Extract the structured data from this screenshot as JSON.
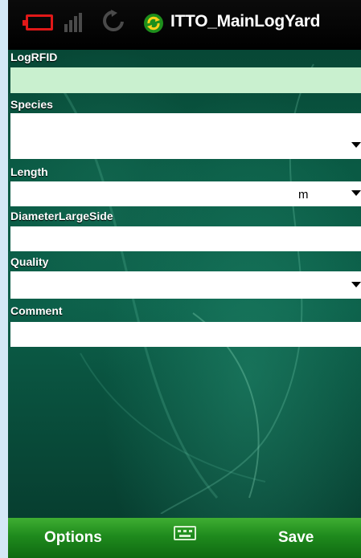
{
  "status_bar": {
    "app_title": "ITTO_MainLogYard",
    "icons": [
      "battery-icon",
      "signal-icon",
      "sync-gray-icon",
      "sync-green-icon"
    ]
  },
  "form": {
    "logrfid": {
      "label": "LogRFID",
      "value": ""
    },
    "species": {
      "label": "Species",
      "value": ""
    },
    "length": {
      "label": "Length",
      "value": "",
      "unit": "m"
    },
    "diameter": {
      "label": "DiameterLargeSide",
      "value": ""
    },
    "quality": {
      "label": "Quality",
      "value": ""
    },
    "comment": {
      "label": "Comment",
      "value": ""
    }
  },
  "softkeys": {
    "left_label": "Options",
    "right_label": "Save",
    "center_icon": "keyboard-icon"
  },
  "colors": {
    "accent_green": "#2a9a25",
    "rfid_field_bg": "#c9f0cf",
    "battery_red": "#e01818"
  }
}
